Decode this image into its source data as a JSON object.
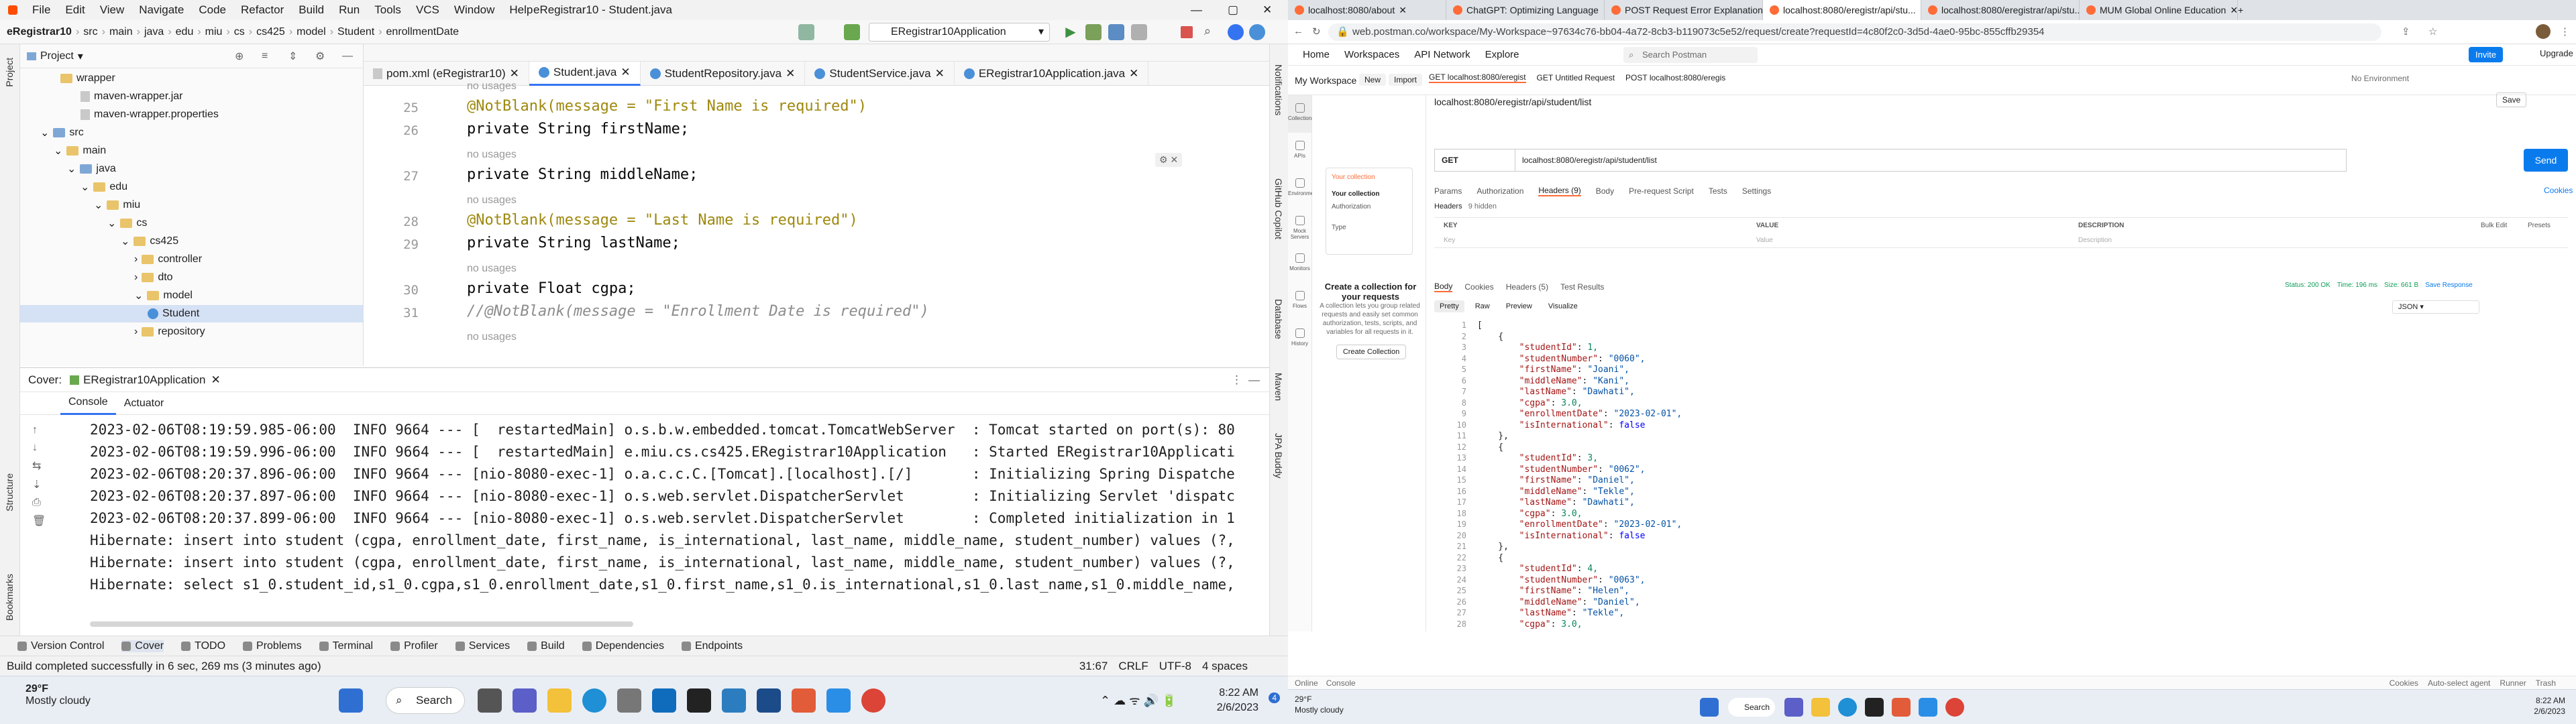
{
  "ide": {
    "menu": [
      "File",
      "Edit",
      "View",
      "Navigate",
      "Code",
      "Refactor",
      "Build",
      "Run",
      "Tools",
      "VCS",
      "Window",
      "Help"
    ],
    "title": "eRegistrar10 - Student.java",
    "breadcrumbs": [
      "eRegistrar10",
      "src",
      "main",
      "java",
      "edu",
      "miu",
      "cs",
      "cs425",
      "model",
      "Student",
      "enrollmentDate"
    ],
    "run_config": "ERegistrar10Application",
    "project_panel_title": "Project",
    "tree": [
      {
        "label": "wrapper",
        "kind": "folder"
      },
      {
        "label": "maven-wrapper.jar",
        "kind": "file"
      },
      {
        "label": "maven-wrapper.properties",
        "kind": "file"
      },
      {
        "label": "src",
        "kind": "src"
      },
      {
        "label": "main",
        "kind": "folder"
      },
      {
        "label": "java",
        "kind": "src"
      },
      {
        "label": "edu",
        "kind": "folder"
      },
      {
        "label": "miu",
        "kind": "folder"
      },
      {
        "label": "cs",
        "kind": "folder"
      },
      {
        "label": "cs425",
        "kind": "folder"
      },
      {
        "label": "controller",
        "kind": "folder"
      },
      {
        "label": "dto",
        "kind": "folder"
      },
      {
        "label": "model",
        "kind": "folder"
      },
      {
        "label": "Student",
        "kind": "class"
      },
      {
        "label": "repository",
        "kind": "folder"
      }
    ],
    "editor_tabs": [
      {
        "label": "pom.xml (eRegistrar10)",
        "active": false
      },
      {
        "label": "Student.java",
        "active": true
      },
      {
        "label": "StudentRepository.java",
        "active": false
      },
      {
        "label": "StudentService.java",
        "active": false
      },
      {
        "label": "ERegistrar10Application.java",
        "active": false
      }
    ],
    "code": [
      {
        "ln": "",
        "usage": "no usages"
      },
      {
        "ln": "25",
        "text": "@NotBlank(message = \"First Name is required\")"
      },
      {
        "ln": "26",
        "text": "private String firstName;"
      },
      {
        "ln": "",
        "usage": "no usages"
      },
      {
        "ln": "27",
        "text": "private String middleName;"
      },
      {
        "ln": "",
        "usage": "no usages"
      },
      {
        "ln": "28",
        "text": "@NotBlank(message = \"Last Name is required\")"
      },
      {
        "ln": "29",
        "text": "private String lastName;"
      },
      {
        "ln": "",
        "usage": "no usages"
      },
      {
        "ln": "30",
        "text": "private Float cgpa;"
      },
      {
        "ln": "31",
        "text": "//@NotBlank(message = \"Enrollment Date is required\")"
      },
      {
        "ln": "",
        "usage": "no usages"
      }
    ],
    "cover_label": "Cover:",
    "cover_target": "ERegistrar10Application",
    "console_tabs": [
      "Console",
      "Actuator"
    ],
    "console": [
      "2023-02-06T08:19:59.985-06:00  INFO 9664 --- [  restartedMain] o.s.b.w.embedded.tomcat.TomcatWebServer  : Tomcat started on port(s): 80",
      "2023-02-06T08:19:59.996-06:00  INFO 9664 --- [  restartedMain] e.miu.cs.cs425.ERegistrar10Application   : Started ERegistrar10Applicati",
      "2023-02-06T08:20:37.896-06:00  INFO 9664 --- [nio-8080-exec-1] o.a.c.c.C.[Tomcat].[localhost].[/]       : Initializing Spring Dispatche",
      "2023-02-06T08:20:37.897-06:00  INFO 9664 --- [nio-8080-exec-1] o.s.web.servlet.DispatcherServlet        : Initializing Servlet 'dispatc",
      "2023-02-06T08:20:37.899-06:00  INFO 9664 --- [nio-8080-exec-1] o.s.web.servlet.DispatcherServlet        : Completed initialization in 1",
      "Hibernate: insert into student (cgpa, enrollment_date, first_name, is_international, last_name, middle_name, student_number) values (?,",
      "Hibernate: insert into student (cgpa, enrollment_date, first_name, is_international, last_name, middle_name, student_number) values (?,",
      "Hibernate: select s1_0.student_id,s1_0.cgpa,s1_0.enrollment_date,s1_0.first_name,s1_0.is_international,s1_0.last_name,s1_0.middle_name,"
    ],
    "tool_windows": [
      "Version Control",
      "Cover",
      "TODO",
      "Problems",
      "Terminal",
      "Profiler",
      "Services",
      "Build",
      "Dependencies",
      "Endpoints"
    ],
    "status_msg": "Build completed successfully in 6 sec, 269 ms (3 minutes ago)",
    "status_right": [
      "31:67",
      "CRLF",
      "UTF-8",
      "4 spaces"
    ],
    "left_strip": [
      "Project",
      "Structure",
      "Bookmarks"
    ],
    "right_strip": [
      "Notifications",
      "GitHub Copilot",
      "Database",
      "Maven",
      "JPA Buddy"
    ]
  },
  "taskbar": {
    "weather_temp": "29°F",
    "weather_desc": "Mostly cloudy",
    "search": "Search",
    "time": "8:22 AM",
    "date": "2/6/2023",
    "badge": "4"
  },
  "browser": {
    "tabs": [
      {
        "label": "localhost:8080/about",
        "active": false
      },
      {
        "label": "ChatGPT: Optimizing Language",
        "active": false
      },
      {
        "label": "POST Request Error Explanation",
        "active": false
      },
      {
        "label": "localhost:8080/eregistr/api/stu...",
        "active": true
      },
      {
        "label": "localhost:8080/eregistrar/api/stu...",
        "active": false
      },
      {
        "label": "MUM Global Online Education",
        "active": false
      }
    ],
    "url": "web.postman.co/workspace/My-Workspace~97634c76-bb04-4a72-8cb3-b119073c5e52/request/create?requestId=4c80f2c0-3d5d-4ae0-95bc-855cffb29354"
  },
  "postman": {
    "nav": [
      "Home",
      "Workspaces",
      "API Network",
      "Explore"
    ],
    "search": "Search Postman",
    "invite": "Invite",
    "upgrade": "Upgrade",
    "workspace": "My Workspace",
    "new_btn": "New",
    "import_btn": "Import",
    "req_tabs": [
      "GET localhost:8080/eregist",
      "GET Untitled Request",
      "POST localhost:8080/eregis"
    ],
    "env": "No Environment",
    "req_title": "localhost:8080/eregistr/api/student/list",
    "save": "Save",
    "method": "GET",
    "req_url": "localhost:8080/eregistr/api/student/list",
    "send": "Send",
    "side_items": [
      "Collections",
      "APIs",
      "Environments",
      "Mock Servers",
      "Monitors",
      "Flows",
      "History"
    ],
    "req_subtabs": [
      "Params",
      "Authorization",
      "Headers (9)",
      "Body",
      "Pre-request Script",
      "Tests",
      "Settings"
    ],
    "cookies": "Cookies",
    "headers_label": "Headers",
    "hidden": "9 hidden",
    "kv_cols": [
      "KEY",
      "VALUE",
      "DESCRIPTION"
    ],
    "kv_placeholder": [
      "Key",
      "Value",
      "Description"
    ],
    "bulk_edit": "Bulk Edit",
    "presets": "Presets",
    "coll_title": "Create a collection for your requests",
    "coll_desc": "A collection lets you group related requests and easily set common authorization, tests, scripts, and variables for all requests in it.",
    "coll_btn": "Create Collection",
    "coll_preview": {
      "title": "Your collection",
      "auth": "Authorization",
      "type": "Type"
    },
    "resp_tabs": [
      "Body",
      "Cookies",
      "Headers (5)",
      "Test Results"
    ],
    "status": "Status: 200 OK",
    "time": "Time: 196 ms",
    "size": "Size: 661 B",
    "save_resp": "Save Response",
    "view_tabs": [
      "Pretty",
      "Raw",
      "Preview",
      "Visualize"
    ],
    "format": "JSON",
    "json_lines": [
      "[",
      "    {",
      "        \"studentId\": 1,",
      "        \"studentNumber\": \"0060\",",
      "        \"firstName\": \"Joani\",",
      "        \"middleName\": \"Kani\",",
      "        \"lastName\": \"Dawhati\",",
      "        \"cgpa\": 3.0,",
      "        \"enrollmentDate\": \"2023-02-01\",",
      "        \"isInternational\": false",
      "    },",
      "    {",
      "        \"studentId\": 3,",
      "        \"studentNumber\": \"0062\",",
      "        \"firstName\": \"Daniel\",",
      "        \"middleName\": \"Tekle\",",
      "        \"lastName\": \"Dawhati\",",
      "        \"cgpa\": 3.0,",
      "        \"enrollmentDate\": \"2023-02-01\",",
      "        \"isInternational\": false",
      "    },",
      "    {",
      "        \"studentId\": 4,",
      "        \"studentNumber\": \"0063\",",
      "        \"firstName\": \"Helen\",",
      "        \"middleName\": \"Daniel\",",
      "        \"lastName\": \"Tekle\",",
      "        \"cgpa\": 3.0,"
    ],
    "bottom_left": [
      "Online",
      "Console"
    ],
    "bottom_right": [
      "Cookies",
      "Auto-select agent",
      "Runner",
      "Trash"
    ]
  }
}
